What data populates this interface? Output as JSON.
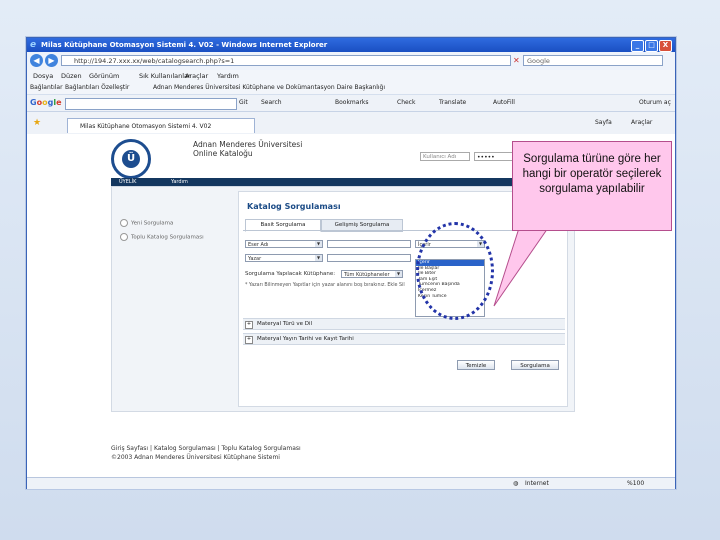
{
  "window": {
    "title": "Milas Kütüphane Otomasyon Sistemi 4. V02 - Windows Internet Explorer",
    "controls": [
      "_",
      "□",
      "X"
    ]
  },
  "address_bar": {
    "url": "http://194.27.xxx.xx/web/catalogsearch.php?s=1",
    "search_placeholder": "Google"
  },
  "menu": [
    "Dosya",
    "Düzen",
    "Görünüm",
    "Sık Kullanılanlar",
    "Araçlar",
    "Yardım"
  ],
  "links": {
    "label": "Bağlantılar",
    "items": [
      "Bağlantıları Özelleştir",
      "Adnan Menderes Üniversitesi Kütüphane ve Dokümantasyon Daire Başkanlığı"
    ]
  },
  "google_toolbar": {
    "logo": "Google",
    "go_label": "Git",
    "items": [
      "Search",
      "Bookmarks",
      "Check",
      "Translate",
      "AutoFill",
      "Oturum aç"
    ]
  },
  "tab": {
    "label": "Milas Kütüphane Otomasyon Sistemi 4. V02",
    "tools": [
      "Sayfa",
      "Araçlar"
    ]
  },
  "page": {
    "university": [
      "Adnan Menderes Üniversitesi",
      "Online Kataloğu"
    ],
    "login": {
      "user_placeholder": "Kullanıcı Adı",
      "password_mask": "•••••"
    },
    "nav": [
      "ÜYELİK",
      "Yardım"
    ],
    "side_options": [
      "Yeni Sorgulama",
      "Toplu Katalog Sorgulaması"
    ],
    "panel_title": "Katalog Sorgulaması",
    "subtabs": [
      "Basit Sorgulama",
      "Gelişmiş Sorgulama"
    ],
    "field1": "Eser Adı",
    "field2": "Yazar",
    "field3": "Konu",
    "field4": "Yayın Yılı",
    "operator_selected": "İçerir",
    "operator_options": [
      "İçerir",
      "İle Başlar",
      "İle Biter",
      "Tam Eşit",
      "Tümcenin Başında",
      "İçermez",
      "Kesin Tümce"
    ],
    "library_label": "Sorgulama Yapılacak Kütüphane:",
    "library_value": "Tüm Kütüphaneler",
    "note": "* Yazarı Bilinmeyen Yapıtlar için yazar alanını boş bırakınız. Ekle   Sil",
    "sections": [
      "Materyal Türü ve Dil",
      "Materyal Yayın Tarihi ve Kayıt Tarihi"
    ],
    "buttons": {
      "clear": "Temizle",
      "search": "Sorgulama"
    },
    "footer": [
      "Giriş Sayfası | Katalog Sorgulaması | Toplu Katalog Sorgulaması",
      "©2003 Adnan Menderes Üniversitesi Kütüphane Sistemi"
    ]
  },
  "status": {
    "zone": "Internet",
    "zoom": "%100"
  },
  "callout": {
    "text": "Sorgulama türüne göre her hangi bir operatör seçilerek sorgulama yapılabilir"
  },
  "colors": {
    "titlebar": "#1a4fc2",
    "callout_fill": "#ffc7ec",
    "callout_border": "#b54e8d",
    "ellipse": "#2334a8",
    "nav_dark": "#14375f"
  }
}
